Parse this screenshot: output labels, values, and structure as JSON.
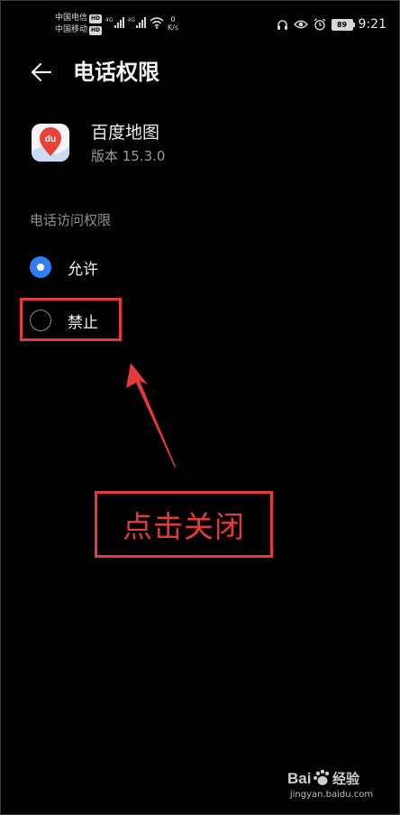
{
  "status_bar": {
    "carrier_1": "中国电信",
    "carrier_2": "中国移动",
    "hd": "HD",
    "network": "4G",
    "speed_value": "0",
    "speed_unit": "K/s",
    "battery": "89",
    "time": "9:21"
  },
  "header": {
    "title": "电话权限"
  },
  "app": {
    "name": "百度地图",
    "version": "版本 15.3.0",
    "icon_text": "du"
  },
  "section": {
    "label": "电话访问权限"
  },
  "options": [
    {
      "label": "允许",
      "checked": true
    },
    {
      "label": "禁止",
      "checked": false
    }
  ],
  "annotation": {
    "callout": "点击关闭",
    "color": "#e6393c"
  },
  "watermark": {
    "url": "jingyan.baidu.com"
  },
  "colors": {
    "background": "#000000",
    "accent": "#2f7ff0",
    "app_icon_red": "#e8413b"
  }
}
